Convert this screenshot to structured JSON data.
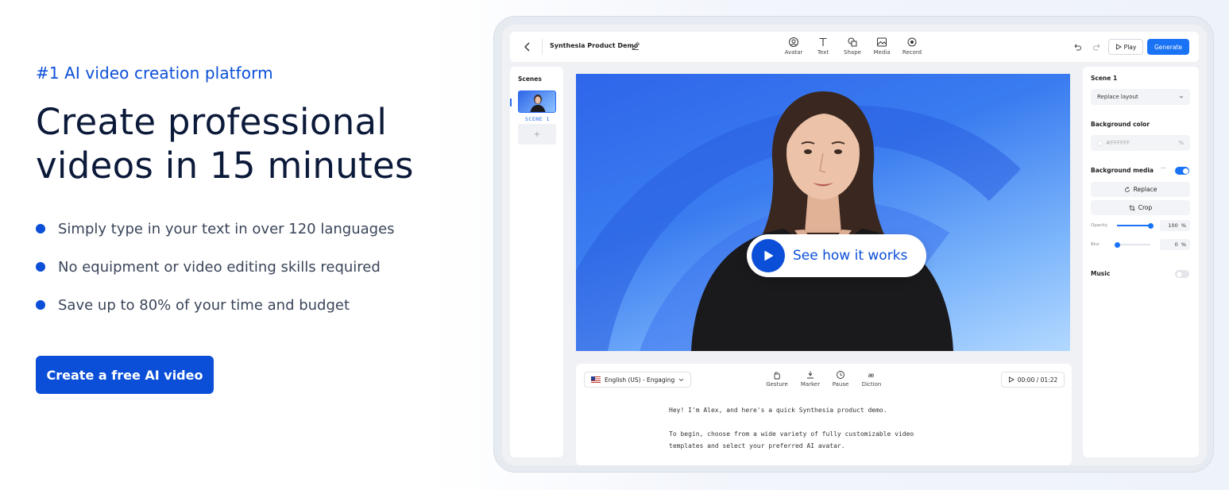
{
  "hero": {
    "eyebrow": "#1 AI video creation platform",
    "headline_line1": "Create professional",
    "headline_line2": "videos in 15 minutes",
    "bullets": [
      "Simply type in your text in over 120 languages",
      "No equipment or video editing skills required",
      "Save up to 80% of your time and budget"
    ],
    "cta_label": "Create a free AI video"
  },
  "colors": {
    "brand_blue": "#0b4fd8",
    "generate_blue": "#1a73f5",
    "headline": "#0c1a3a"
  },
  "editor": {
    "project_title": "Synthesia Product Demo",
    "tools": [
      {
        "label": "Avatar",
        "icon": "avatar-icon"
      },
      {
        "label": "Text",
        "icon": "text-icon"
      },
      {
        "label": "Shape",
        "icon": "shape-icon"
      },
      {
        "label": "Media",
        "icon": "media-icon"
      },
      {
        "label": "Record",
        "icon": "record-icon"
      }
    ],
    "play_label": "Play",
    "generate_label": "Generate",
    "scenes": {
      "title": "Scenes",
      "scene_label": "SCENE 1",
      "add_label": "+"
    },
    "canvas": {
      "see_how_label": "See how it works"
    },
    "script": {
      "language": "English (US) - Engaging",
      "tools": [
        {
          "label": "Gesture",
          "icon": "gesture-icon"
        },
        {
          "label": "Marker",
          "icon": "marker-icon"
        },
        {
          "label": "Pause",
          "icon": "pause-icon"
        },
        {
          "label": "Diction",
          "icon": "diction-icon"
        }
      ],
      "timer": "00:00 / 01:22",
      "line1": "Hey! I'm Alex, and here's a quick Synthesia product demo.",
      "line2": "To begin, choose from a wide variety of fully customizable video",
      "line3": "templates and select your preferred AI avatar."
    },
    "properties": {
      "scene_title": "Scene 1",
      "layout_select": "Replace layout",
      "bg_color_title": "Background color",
      "bg_color_value": "#FFFFFF",
      "bg_color_unit": "%",
      "bg_media_title": "Background media",
      "bg_media_more": "···",
      "bg_media_enabled": true,
      "replace_label": "Replace",
      "crop_label": "Crop",
      "opacity_label": "Opacity",
      "opacity_value": "100",
      "opacity_fraction": 1.0,
      "blur_label": "Blur",
      "blur_value": "0",
      "blur_fraction": 0.0,
      "percent": "%",
      "music_title": "Music",
      "music_enabled": false
    }
  }
}
